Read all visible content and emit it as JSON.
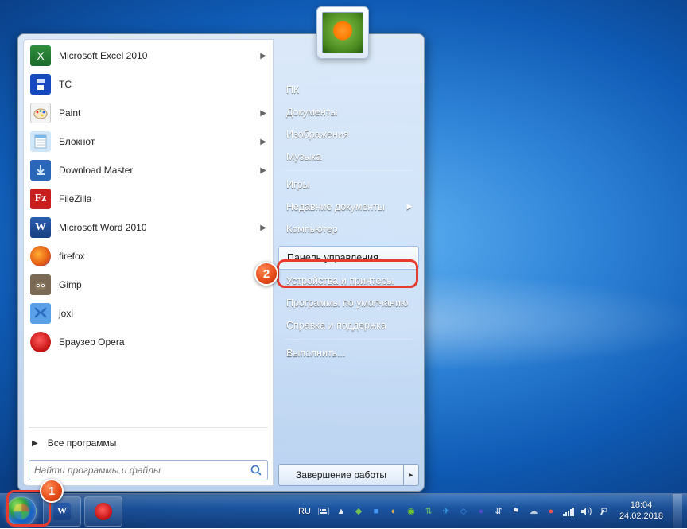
{
  "start_menu": {
    "programs": [
      {
        "label": "Microsoft Excel 2010",
        "icon": "excel",
        "submenu": true
      },
      {
        "label": "TC",
        "icon": "tc",
        "submenu": false
      },
      {
        "label": "Paint",
        "icon": "paint",
        "submenu": true
      },
      {
        "label": "Блокнот",
        "icon": "notepad",
        "submenu": true
      },
      {
        "label": "Download Master",
        "icon": "download-master",
        "submenu": true
      },
      {
        "label": "FileZilla",
        "icon": "filezilla",
        "submenu": false
      },
      {
        "label": "Microsoft Word 2010",
        "icon": "word",
        "submenu": true
      },
      {
        "label": "firefox",
        "icon": "firefox",
        "submenu": false
      },
      {
        "label": "Gimp",
        "icon": "gimp",
        "submenu": false
      },
      {
        "label": "joxi",
        "icon": "joxi",
        "submenu": false
      },
      {
        "label": "Браузер Opera",
        "icon": "opera",
        "submenu": false
      }
    ],
    "all_programs_label": "Все программы",
    "search_placeholder": "Найти программы и файлы",
    "right_items": [
      {
        "label": "ПК",
        "submenu": false
      },
      {
        "label": "Документы",
        "submenu": false
      },
      {
        "label": "Изображения",
        "submenu": false
      },
      {
        "label": "Музыка",
        "submenu": false
      },
      {
        "sep": true
      },
      {
        "label": "Игры",
        "submenu": false
      },
      {
        "label": "Недавние документы",
        "submenu": true
      },
      {
        "label": "Компьютер",
        "submenu": false
      },
      {
        "sep": true
      },
      {
        "label": "Панель управления",
        "submenu": false,
        "highlighted": true
      },
      {
        "label": "Устройства и принтеры",
        "submenu": false
      },
      {
        "label": "Программы по умолчанию",
        "submenu": false
      },
      {
        "label": "Справка и поддержка",
        "submenu": false
      },
      {
        "sep": true
      },
      {
        "label": "Выполнить...",
        "submenu": false
      }
    ],
    "shutdown_label": "Завершение работы"
  },
  "annotations": {
    "callout_1": "1",
    "callout_2": "2"
  },
  "taskbar": {
    "lang": "RU",
    "pinned": [
      "word",
      "opera"
    ],
    "tray_icons": [
      "keyboard",
      "tray-up",
      "shield",
      "qbit",
      "update",
      "nvidia",
      "usb",
      "telegram",
      "dropbox",
      "antivirus",
      "network",
      "flag",
      "onedrive",
      "opera",
      "volume",
      "battery"
    ]
  },
  "clock": {
    "time": "18:04",
    "date": "24.02.2018"
  }
}
